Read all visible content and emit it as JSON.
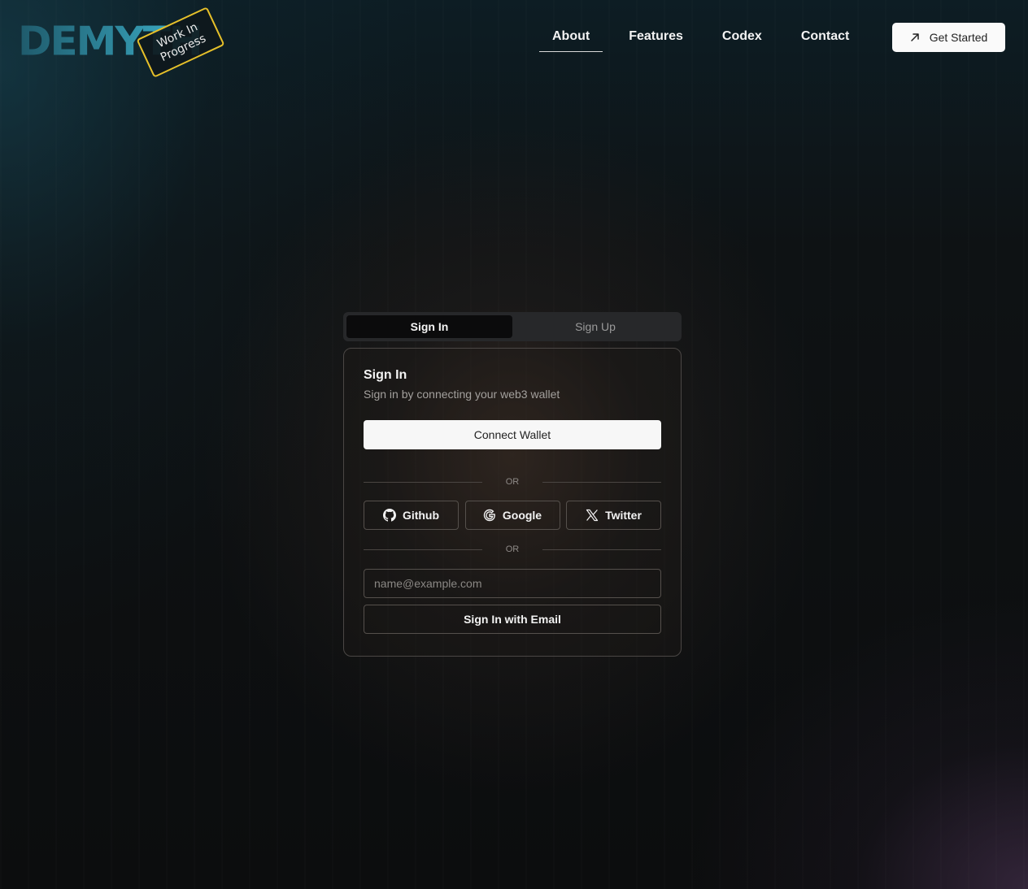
{
  "header": {
    "logo_text": "DEMYTH",
    "badge_line1": "Work In",
    "badge_line2": "Progress",
    "nav": [
      {
        "label": "About",
        "active": true
      },
      {
        "label": "Features",
        "active": false
      },
      {
        "label": "Codex",
        "active": false
      },
      {
        "label": "Contact",
        "active": false
      }
    ],
    "cta_label": "Get Started",
    "cta_icon": "arrow-up-right-icon"
  },
  "auth": {
    "tabs": [
      {
        "label": "Sign In",
        "active": true
      },
      {
        "label": "Sign Up",
        "active": false
      }
    ],
    "title": "Sign In",
    "subtitle": "Sign in by connecting your web3 wallet",
    "connect_wallet_label": "Connect Wallet",
    "or_label": "OR",
    "social": [
      {
        "label": "Github",
        "icon": "github-icon"
      },
      {
        "label": "Google",
        "icon": "google-icon"
      },
      {
        "label": "Twitter",
        "icon": "x-twitter-icon"
      }
    ],
    "email_placeholder": "name@example.com",
    "email_value": "",
    "email_button_label": "Sign In with Email"
  },
  "colors": {
    "accent_teal": "#2f8aa0",
    "badge_border": "#e6c02a",
    "background": "#0c0f11"
  }
}
